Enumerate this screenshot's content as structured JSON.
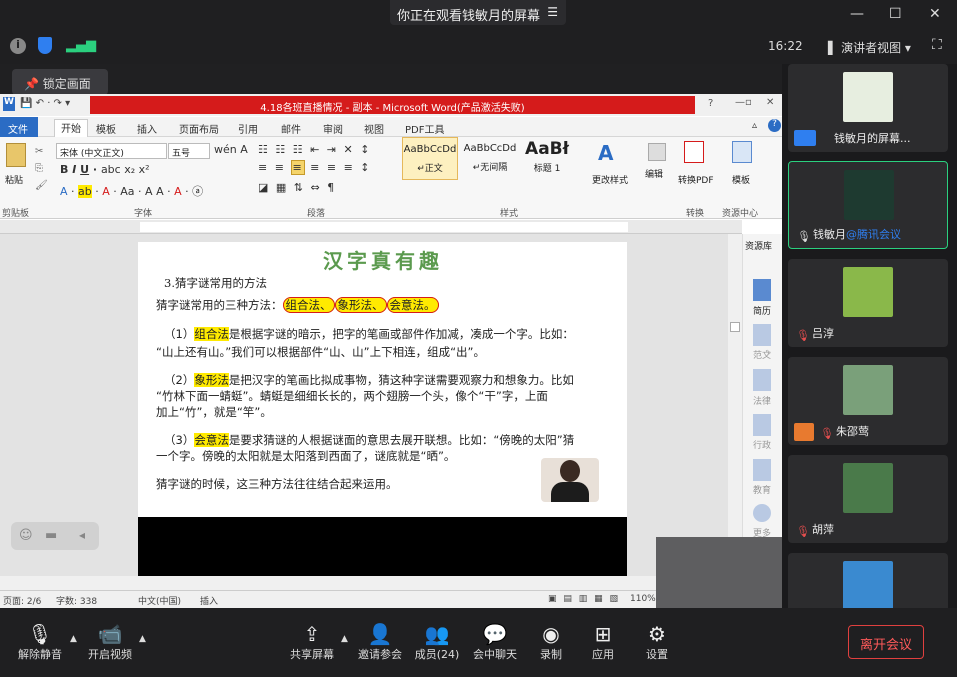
{
  "share_title": "你正在观看钱敏月的屏幕",
  "time": "16:22",
  "presenter_view": "演讲者视图",
  "lock_label": "锁定画面",
  "word": {
    "title": "4.18各班直播情况 - 副本 - Microsoft Word(产品激活失败)",
    "file_tab": "文件",
    "tabs": [
      "开始",
      "模板",
      "插入",
      "页面布局",
      "引用",
      "邮件",
      "审阅",
      "视图",
      "PDF工具"
    ],
    "font_name": "宋体 (中文正文)",
    "font_size": "五号",
    "groups": [
      "剪贴板",
      "字体",
      "段落",
      "样式",
      "转换",
      "资源中心"
    ],
    "paste": "粘贴",
    "styles": [
      {
        "preview": "AaBbCcDd",
        "label": "↵正文"
      },
      {
        "preview": "AaBbCcDd",
        "label": "↵无间隔"
      },
      {
        "preview": "AaBł",
        "label": "标题 1"
      }
    ],
    "more_styles": "更改样式",
    "edit": "编辑",
    "to_pdf": "转换PDF",
    "template": "模板",
    "side": [
      "资源库",
      "简历",
      "范文",
      "法律",
      "行政",
      "教育",
      "更多"
    ],
    "status": {
      "page": "页面: 2/6",
      "words": "字数: 338",
      "lang": "中文(中国)",
      "mode": "插入",
      "zoom": "110%"
    }
  },
  "page": {
    "title": "汉字真有趣",
    "heading": "3.猜字谜常用的方法",
    "intro": "猜字谜常用的三种方法：",
    "m1": "组合法、",
    "m2": "象形法、",
    "m3": "会意法。",
    "p1a": "（1）",
    "p1h": "组合法",
    "p1b": "是根据字谜的暗示，把字的笔画或部件作加减，凑成一个字。比如：",
    "p1c": "“山上还有山。”我们可以根据部件“山、山”上下相连，组成“出”。",
    "p2a": "（2）",
    "p2h": "象形法",
    "p2b": "是把汉字的笔画比拟成事物，猜这种字谜需要观察力和想象力。比如",
    "p2c": "“竹林下面一蜻蜓”。蜻蜓是细细长长的，两个翅膀一个头，像个“干”字，上面",
    "p2d": "加上“竹”，就是“竿”。",
    "p3a": "（3）",
    "p3h": "会意法",
    "p3b": "是要求猜谜的人根据谜面的意思去展开联想。比如：“傍晚的太阳”猜",
    "p3c": "一个字。傍晚的太阳就是太阳落到西面了，谜底就是“晒”。",
    "p4": "猜字谜的时候，这三种方法往往结合起来运用。"
  },
  "participants": [
    {
      "name": "钱敏月的屏幕...",
      "color": "#5b7a4a"
    },
    {
      "name": "钱敏月",
      "tag": "@腾讯会议",
      "color": "#2a4a3a"
    },
    {
      "name": "吕淳",
      "color": "#6a9a3a"
    },
    {
      "name": "朱邵莺",
      "color": "#7aa07a"
    },
    {
      "name": "胡萍",
      "color": "#4a7a4a"
    },
    {
      "name": "",
      "color": "#3a8ad0"
    }
  ],
  "toolbar": {
    "mute": "解除静音",
    "video": "开启视频",
    "share": "共享屏幕",
    "invite": "邀请参会",
    "members": "成员(24)",
    "chat": "会中聊天",
    "record": "录制",
    "apps": "应用",
    "settings": "设置",
    "leave": "离开会议"
  }
}
